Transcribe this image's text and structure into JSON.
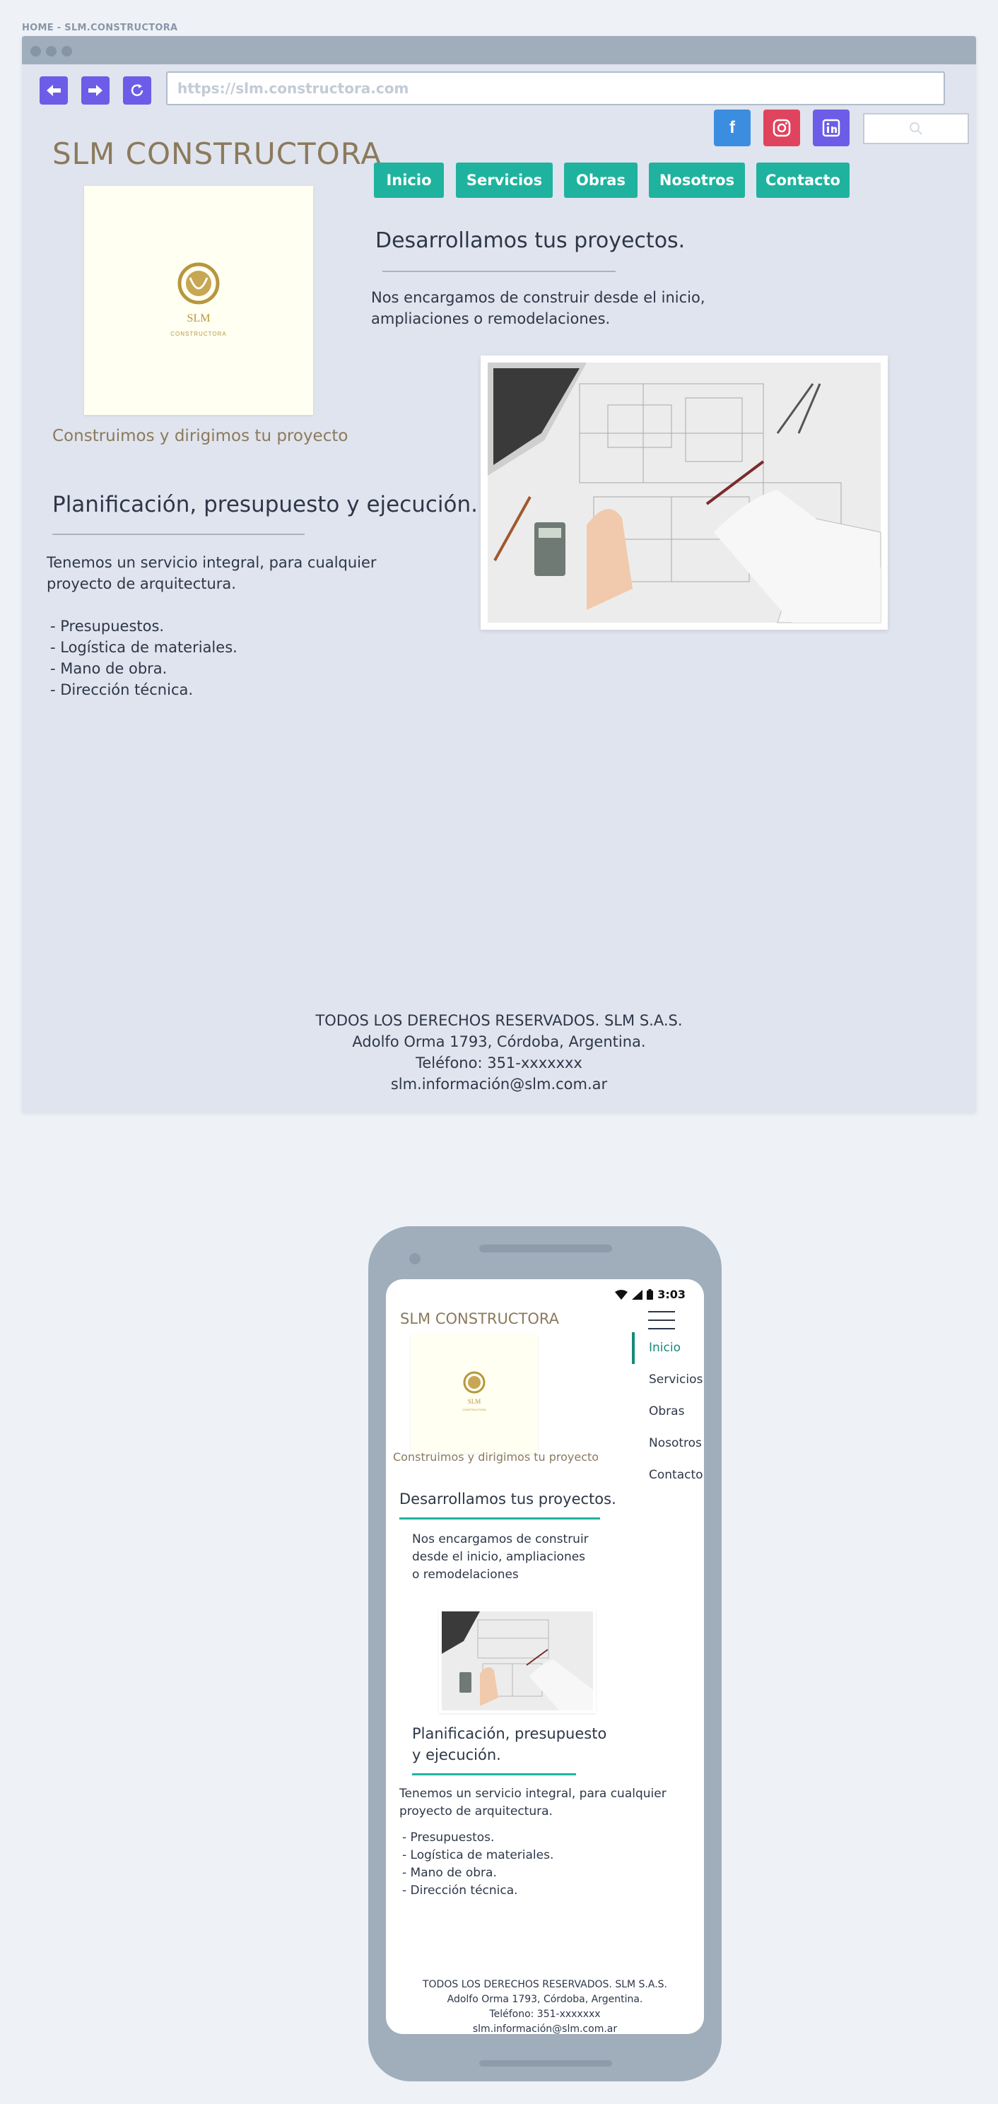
{
  "breadcrumb": "HOME - SLM.CONSTRUCTORA",
  "browser": {
    "back_icon": "arrow-left-icon",
    "forward_icon": "arrow-right-icon",
    "reload_icon": "reload-icon",
    "url_placeholder": "https://slm.constructora.com"
  },
  "social": [
    {
      "name": "facebook-icon",
      "glyph": "f",
      "color": "#3b8de0"
    },
    {
      "name": "instagram-icon",
      "glyph": "◎",
      "color": "#e0435e"
    },
    {
      "name": "linkedin-icon",
      "glyph": "in",
      "color": "#6c5ce7"
    }
  ],
  "site": {
    "brand": "SLM CONSTRUCTORA",
    "logo": {
      "mark": "SLM",
      "sub": "CONSTRUCTORA"
    },
    "tagline": "Construimos y dirigimos tu proyecto",
    "nav": [
      "Inicio",
      "Servicios",
      "Obras",
      "Nosotros",
      "Contacto"
    ],
    "develop": {
      "title": "Desarrollamos tus proyectos.",
      "text": "Nos encargamos de construir desde el inicio, ampliaciones o remodelaciones."
    },
    "planning": {
      "title": "Planificación, presupuesto y ejecución.",
      "text": "Tenemos un servicio integral, para cualquier proyecto de arquitectura.",
      "items": [
        "- Presupuestos.",
        "- Logística de materiales.",
        "- Mano de obra.",
        "- Dirección técnica."
      ]
    },
    "footer": [
      "TODOS LOS DERECHOS RESERVADOS. SLM S.A.S.",
      "Adolfo Orma 1793, Córdoba, Argentina.",
      "Teléfono: 351-xxxxxxx",
      "slm.información@slm.com.ar"
    ]
  },
  "mobile": {
    "time": "3:03",
    "develop_text": "Nos encargamos de construir desde el inicio, ampliaciones o remodelaciones",
    "active_nav": "Inicio"
  },
  "colors": {
    "accent": "#1fb39f",
    "brand": "#8b7a5c",
    "button": "#6c5ce7",
    "gold": "#b8963e"
  }
}
